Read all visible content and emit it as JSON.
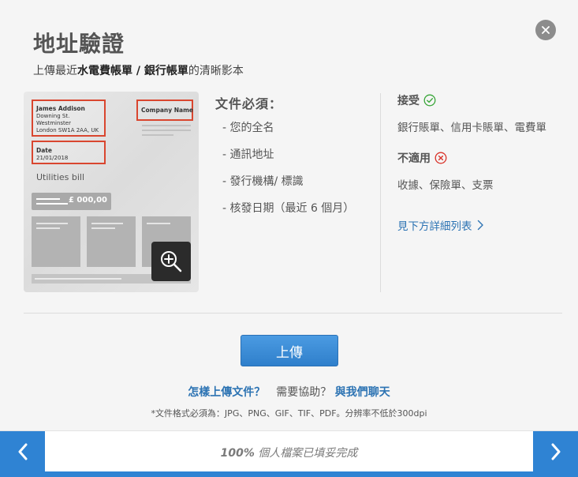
{
  "modal": {
    "title": "地址驗證",
    "subtitle": {
      "prefix": "上傳最近",
      "bold1": "水電費帳單",
      "sep": " / ",
      "bold2": "銀行帳單",
      "suffix": "的清晰影本"
    },
    "close_icon": "close-icon"
  },
  "sample_bill": {
    "name": "James Addison",
    "addr1": "Downing St.",
    "addr2": "Westminster",
    "addr3": "London SW1A 2AA, UK",
    "company": "Company Name",
    "date_label": "Date",
    "date_value": "21/01/2018",
    "doc_type": "Utilities bill",
    "amount": "£ 000,00",
    "zoom_icon": "zoom-in-icon"
  },
  "must_have": {
    "title": "文件必須：",
    "items": [
      "- 您的全名",
      "- 通訊地址",
      "- 發行機構/ 標識",
      "- 核發日期（最近 6 個月）"
    ]
  },
  "accepted": {
    "title": "接受",
    "icon": "check-circle-icon",
    "text": "銀行賬單、信用卡賬單、電費單"
  },
  "not_applicable": {
    "title": "不適用",
    "icon": "x-circle-icon",
    "text": "收據、保險單、支票"
  },
  "see_list": {
    "label": "見下方詳細列表",
    "icon": "chevron-right-icon"
  },
  "upload_button": "上傳",
  "help": {
    "how_link": "怎樣上傳文件？",
    "need_help": "需要協助？",
    "chat_link": "與我們聊天"
  },
  "format_note": "*文件格式必須為：JPG、PNG、GIF、TIF、PDF。分辨率不低於300dpi",
  "nav": {
    "progress_value": "100%",
    "progress_text": " 個人檔案已填妥完成",
    "progress_fraction": 1.0,
    "prev_icon": "chevron-left-icon",
    "next_icon": "chevron-right-icon"
  },
  "colors": {
    "accent": "#2f83d3",
    "link": "#2c73b3",
    "highlight_box": "#d9462f",
    "accept_green": "#3aa63a",
    "reject_red": "#d9342b"
  }
}
